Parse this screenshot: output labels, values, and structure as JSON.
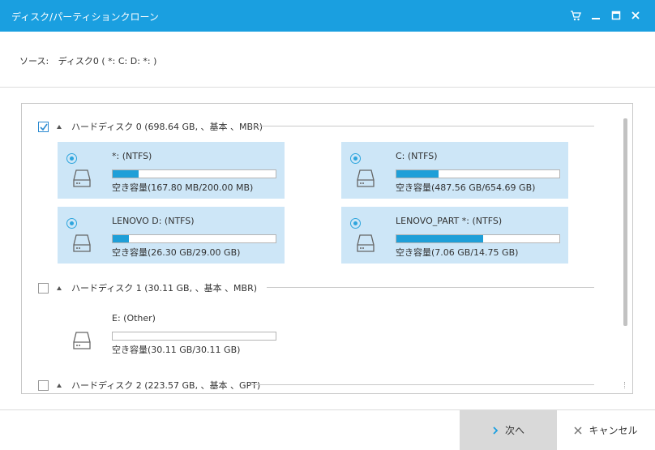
{
  "window": {
    "title": "ディスク/パーティションクローン",
    "icons": [
      "cart-icon",
      "minimize-icon",
      "maximize-icon",
      "close-icon"
    ]
  },
  "source": {
    "label": "ソース:",
    "value": "ディスク0 ( *: C: D: *: )"
  },
  "disks": [
    {
      "title": "ハードディスク 0 (698.64 GB, 、基本 、MBR)",
      "checked": true,
      "partitions": [
        {
          "name": "*: (NTFS)",
          "free": "空き容量(167.80 MB/200.00 MB)",
          "used_fraction": 0.16,
          "selected": true
        },
        {
          "name": "C: (NTFS)",
          "free": "空き容量(487.56 GB/654.69 GB)",
          "used_fraction": 0.26,
          "selected": true
        },
        {
          "name": "LENOVO D: (NTFS)",
          "free": "空き容量(26.30 GB/29.00 GB)",
          "used_fraction": 0.1,
          "selected": true
        },
        {
          "name": "LENOVO_PART *: (NTFS)",
          "free": "空き容量(7.06 GB/14.75 GB)",
          "used_fraction": 0.53,
          "selected": true
        }
      ]
    },
    {
      "title": "ハードディスク 1 (30.11 GB, 、基本 、MBR)",
      "checked": false,
      "partitions": [
        {
          "name": "E: (Other)",
          "free": "空き容量(30.11 GB/30.11 GB)",
          "used_fraction": 0.0,
          "selected": false
        }
      ]
    },
    {
      "title": "ハードディスク 2 (223.57 GB, 、基本 、GPT)",
      "checked": false,
      "partitions": []
    }
  ],
  "buttons": {
    "next": "次へ",
    "cancel": "キャンセル"
  },
  "colors": {
    "titlebar": "#1a9fe0",
    "selected_bg": "#cde6f7",
    "bar_fill": "#1e9fd8"
  }
}
